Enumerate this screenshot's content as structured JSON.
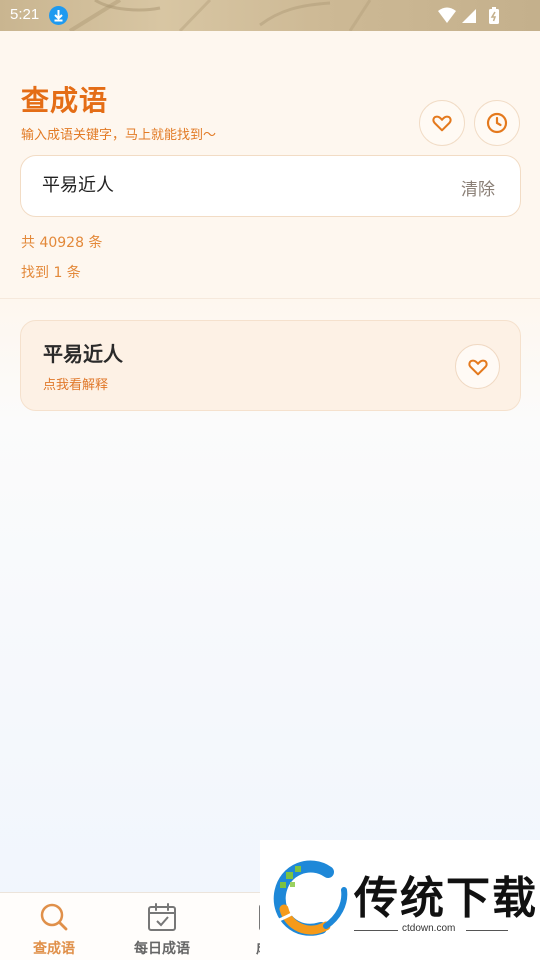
{
  "status_bar": {
    "time": "5:21"
  },
  "header": {
    "title": "查成语",
    "subtitle": "输入成语关键字，马上就能找到～"
  },
  "search": {
    "value": "平易近人",
    "clear_label": "清除"
  },
  "stats": {
    "total": "共 40928 条",
    "found": "找到 1 条"
  },
  "results": [
    {
      "idiom": "平易近人",
      "hint": "点我看解释"
    }
  ],
  "bottom_nav": [
    {
      "label": "查成语",
      "icon": "search-icon",
      "active": true
    },
    {
      "label": "每日成语",
      "icon": "calendar-icon",
      "active": false
    },
    {
      "label": "成语",
      "icon": "book-icon",
      "active": false
    }
  ],
  "watermark": {
    "brand": "传统下载",
    "url": "ctdown.com"
  },
  "colors": {
    "accent": "#e46d16",
    "accent_light": "#e3893a",
    "card_bg": "#fdf1e5"
  }
}
